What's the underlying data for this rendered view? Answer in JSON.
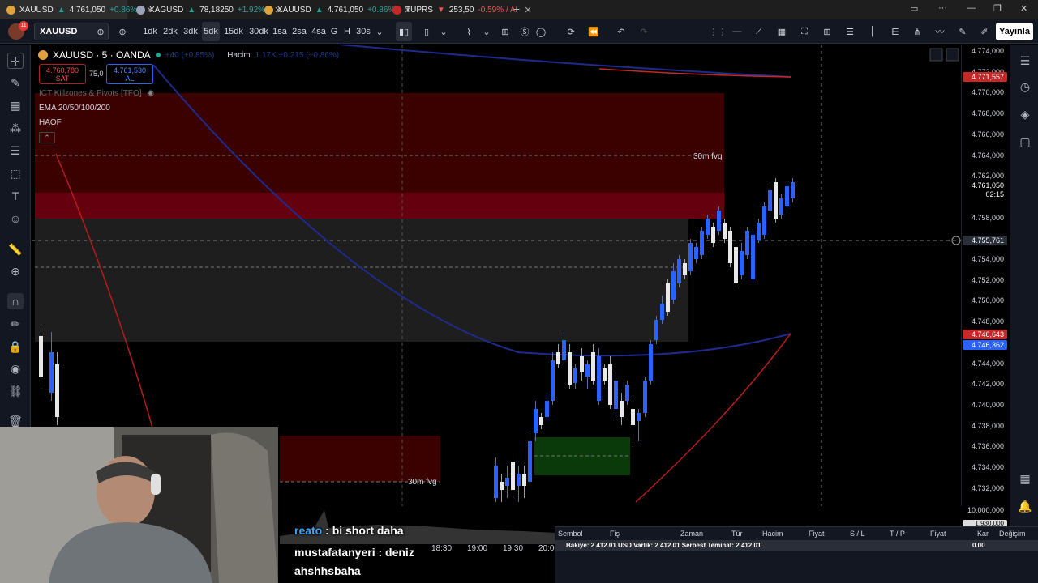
{
  "browser": {
    "tabs": [
      {
        "symbol": "XAUUSD",
        "arrow": "▲",
        "price": "4.761,050",
        "change": "+0.86%",
        "dir": "up"
      },
      {
        "symbol": "XAGUSD",
        "arrow": "▲",
        "price": "78,18250",
        "change": "+1.92%",
        "dir": "up"
      },
      {
        "symbol": "XAUUSD",
        "arrow": "▲",
        "price": "4.761,050",
        "change": "+0.86%",
        "dir": "up"
      },
      {
        "symbol": "TUPRS",
        "arrow": "▼",
        "price": "253,50",
        "change": "-0.59% / A",
        "dir": "down"
      }
    ],
    "new_tab": "+"
  },
  "toolbar": {
    "notifications": "11",
    "symbol": "XAUUSD",
    "intervals": [
      "1dk",
      "2dk",
      "3dk",
      "5dk",
      "15dk",
      "30dk",
      "1sa",
      "2sa",
      "4sa",
      "G",
      "H",
      "30s"
    ],
    "selected_interval": "5dk",
    "publish_label": "Yayınla"
  },
  "legend": {
    "title": "XAUUSD · 5 · OANDA",
    "ohlc": "+40 (+0.85%)",
    "volume_label": "Hacim",
    "volume_values": "1.17K  +0.215 (+0.86%)",
    "sell_price": "4.760,780",
    "sell_label": "SAT",
    "spread": "75,0",
    "buy_price": "4.761,530",
    "buy_label": "AL",
    "indicator_ict": "ICT Killzones & Pivots [TFO]",
    "indicator_ema": "EMA 20/50/100/200",
    "indicator_haof": "HAOF",
    "fvg_label_1": "30m fvg",
    "fvg_label_2": "30m fvg"
  },
  "price_scale": {
    "ticks": [
      "4.774,000",
      "4.772,000",
      "4.770,000",
      "4.768,000",
      "4.766,000",
      "4.764,000",
      "4.762,000",
      "4.760,000",
      "4.758,000",
      "4.756,000",
      "4.754,000",
      "4.752,000",
      "4.750,000",
      "4.748,000",
      "4.746,000",
      "4.744,000",
      "4.742,000",
      "4.740,000",
      "4.738,000",
      "4.736,000",
      "4.734,000",
      "4.732,000"
    ],
    "hidden_ticks": [
      "4.760,000",
      "4.756,000",
      "4.746,000"
    ],
    "current_price": "4.761,050",
    "countdown": "02:15",
    "crosshair_price": "4.755,761",
    "label_red_top": "4.771,557",
    "label_red_mid": "4.746,643",
    "label_blue_mid": "4.746,362",
    "volume_scale": "10.000,000",
    "volume_partial": "1.930,000"
  },
  "time_axis": [
    "18:30",
    "19:00",
    "19:30",
    "20:00"
  ],
  "positions": {
    "headers": [
      "Sembol",
      "Fiş",
      "Zaman",
      "Tür",
      "Hacim",
      "Fiyat",
      "S / L",
      "T / P",
      "Fiyat",
      "Kar",
      "Değişim"
    ],
    "balance_text": "Bakiye: 2 412.01 USD  Varlık: 2 412.01  Serbest Teminat: 2 412.01",
    "pnl": "0.00"
  },
  "chat": [
    {
      "user": "reato",
      "message": "bi short daha",
      "color": "blue"
    },
    {
      "user": "mustafatanyeri",
      "message": "deniz",
      "color": "white"
    },
    {
      "user": "",
      "message": "ahshhsbaha",
      "color": "white"
    }
  ],
  "colors": {
    "bull": "#2962ff",
    "bear": "#e8e8e8",
    "fvg_red": "#4a0000",
    "fvg_green": "#0b3d0b",
    "ema_blue": "#1e2a8c",
    "ema_red": "#c62828"
  },
  "icons": {
    "left_toolbar": [
      "cursor-icon",
      "pen-icon",
      "grid-icon",
      "node-icon",
      "lines-icon",
      "rectangle-icon",
      "text-icon",
      "emoji-icon",
      "ruler-icon",
      "zoom-icon",
      "magnet-icon",
      "pencil-lock-icon",
      "lock-icon",
      "eye-icon",
      "link-icon",
      "trash-icon"
    ],
    "right_toolbar": [
      "list-icon",
      "clock-icon",
      "layers-icon",
      "chat-icon",
      "calendar-icon",
      "bell-icon",
      "grid-icon"
    ]
  }
}
